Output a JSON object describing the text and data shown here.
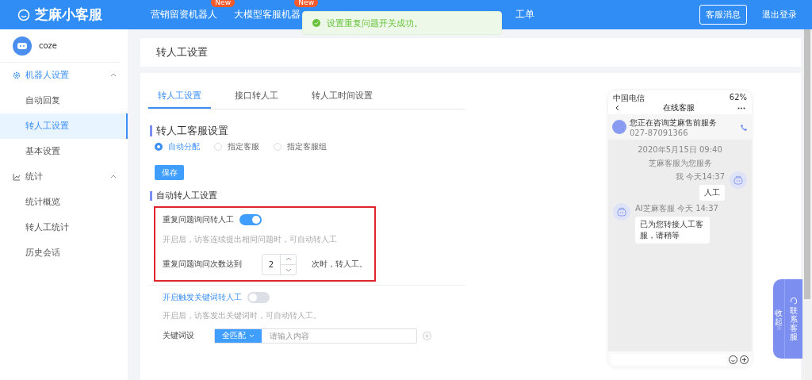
{
  "header": {
    "logo": "芝麻小客服",
    "nav": [
      {
        "label": "营销留资机器人",
        "badge": "New"
      },
      {
        "label": "大模型客服机器",
        "badge": "New"
      },
      {
        "label": "工单"
      }
    ],
    "buttons": [
      {
        "label": "客服消息",
        "kind": "outlined"
      },
      {
        "label": "退出登录",
        "kind": "plain"
      }
    ]
  },
  "toast": {
    "message": "设置重复问题开关成功。"
  },
  "sidebar": {
    "user": "coze",
    "groups": [
      {
        "label": "机器人设置",
        "kind": "gear",
        "expanded": true,
        "active": true,
        "children": [
          {
            "label": "自动回复",
            "selected": false
          },
          {
            "label": "转人工设置",
            "selected": true
          },
          {
            "label": "基本设置",
            "selected": false
          }
        ]
      },
      {
        "label": "统计",
        "kind": "chart",
        "expanded": true,
        "active": false,
        "children": [
          {
            "label": "统计概览",
            "selected": false
          },
          {
            "label": "转人工统计",
            "selected": false
          },
          {
            "label": "历史会话",
            "selected": false
          }
        ]
      }
    ]
  },
  "page_title": "转人工设置",
  "tabs": [
    {
      "label": "转人工设置",
      "selected": true
    },
    {
      "label": "接口转人工",
      "selected": false
    },
    {
      "label": "转人工时间设置",
      "selected": false
    }
  ],
  "assign": {
    "title": "转人工客服设置",
    "options": [
      {
        "label": "自动分配",
        "selected": true
      },
      {
        "label": "指定客服",
        "selected": false
      },
      {
        "label": "指定客服组",
        "selected": false
      }
    ],
    "save": "保存"
  },
  "auto": {
    "title": "自动转人工设置",
    "repeat": {
      "label": "重复问题询问转人工",
      "on": true,
      "hint": "开启后，访客连续提出相同问题时，可自动转人工",
      "count_label": "重复问题询问次数达到",
      "count": "2",
      "suffix": "次时，转人工。"
    },
    "keyword": {
      "label": "开启触发关键词转人工",
      "on": false,
      "hint": "开启后，访客发出关键词时，可自动转人工。",
      "field_label": "关键词设",
      "match": "全匹配",
      "placeholder": "请输入内容"
    }
  },
  "phone": {
    "carrier": "中国电信",
    "battery": "62%",
    "title": "在线客服",
    "banner_title": "您正在咨询芝麻售前服务",
    "banner_phone": "027-87091366",
    "date": "2020年5月15日 09:40",
    "notice": "芝麻客服为您服务",
    "messages": [
      {
        "kind": "me",
        "sender": "我 今天14:37",
        "text": "人工"
      },
      {
        "kind": "bot",
        "sender": "AI芝麻客服 今天 14:37",
        "text": "已为您转接人工客服，请稍等"
      }
    ]
  },
  "float_widget": {
    "collapse": "收起",
    "contact": "联系客服"
  }
}
